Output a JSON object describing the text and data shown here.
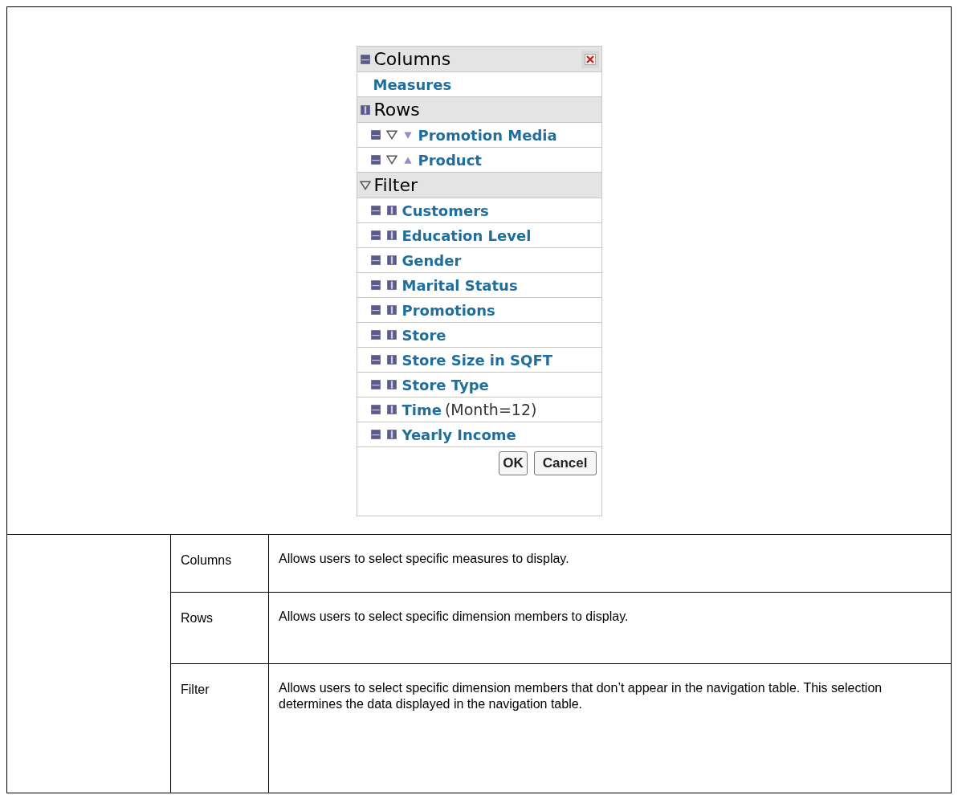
{
  "navigator": {
    "sections": [
      {
        "kind": "columns",
        "title": "Columns",
        "items": [
          {
            "label": "Measures"
          }
        ]
      },
      {
        "kind": "rows",
        "title": "Rows",
        "items": [
          {
            "label": "Promotion Media",
            "descending": true
          },
          {
            "label": "Product",
            "descending": false
          }
        ]
      },
      {
        "kind": "filter",
        "title": "Filter",
        "items": [
          {
            "label": "Customers"
          },
          {
            "label": "Education Level"
          },
          {
            "label": "Gender"
          },
          {
            "label": "Marital Status"
          },
          {
            "label": "Promotions"
          },
          {
            "label": "Store"
          },
          {
            "label": "Store Size in SQFT"
          },
          {
            "label": "Store Type"
          },
          {
            "label": "Time",
            "note": "(Month=12)"
          },
          {
            "label": "Yearly Income"
          }
        ]
      }
    ],
    "buttons": [
      "OK",
      "Cancel"
    ]
  },
  "descriptions": [
    {
      "term": "Columns",
      "text": "Allows users to select specific measures to display."
    },
    {
      "term": "Rows",
      "text": "Allows users to select specific dimension members to display."
    },
    {
      "term": "Filter",
      "text": "Allows users to select specific dimension members that don’t appear in the navigation table. This selection determines the data displayed in the navigation table."
    }
  ]
}
